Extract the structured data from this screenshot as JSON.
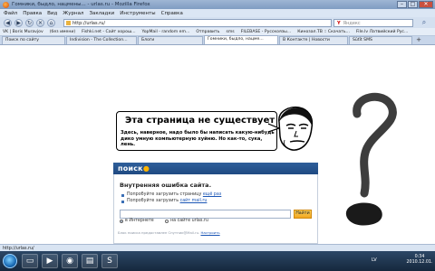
{
  "window": {
    "title": "Гомники, быдло, нацмены... - urlas.ru - Mozilla Firefox",
    "buttons": [
      "–",
      "□",
      "✕"
    ]
  },
  "menu": [
    "Файл",
    "Правка",
    "Вид",
    "Журнал",
    "Закладки",
    "Инструменты",
    "Справка"
  ],
  "nav": {
    "url": "http://urlas.ru/",
    "search_placeholder": "Яндекс",
    "search_engine_glyph": "Y"
  },
  "bookmarks": [
    "VK | Boris Muravjov",
    "(без имени)",
    "Fishki.net - Сайт хорош...",
    "YopMail - random em...",
    "Отправить",
    "sms",
    "FILEBASE - Русскоязы...",
    "Кинозал.ТВ :: Скачать...",
    "File.lv Латвийский Рус..."
  ],
  "tabs": [
    {
      "label": "Поиск по сайту",
      "active": false
    },
    {
      "label": "Indivision - The Collection...",
      "active": false
    },
    {
      "label": "Блоги",
      "active": false
    },
    {
      "label": "Гомники, быдло, нацме...",
      "active": true
    },
    {
      "label": "В Контакте | Новости",
      "active": false
    },
    {
      "label": "Sūtīt SMS",
      "active": false
    }
  ],
  "bubble": {
    "title": "Эта страница не существует",
    "text": "Здесь, наверное, надо было бы написать какую-нибудь дико умную компьютерную хуйню. Но как-то, сука, лень."
  },
  "poisk": {
    "logo": "поиск",
    "error_title": "Внутренняя ошибка сайта.",
    "line1_prefix": "Попробуйте загрузить страницу",
    "line1_link": "ещё раз",
    "line2_prefix": "Попробуйте загрузить",
    "line2_link": "сайт mail.ru",
    "find_button": "Найти",
    "radio_internet": "в Интернете",
    "radio_site": "на сайте urlas.ru",
    "footnote_text": "Блок поиска предоставлен Спутник@Mail.ru.",
    "footnote_link": "Настроить"
  },
  "status": {
    "text": "http://urlas.ru/"
  },
  "taskbar": {
    "lang": "LV",
    "time": "0:34",
    "date": "2010.12.01."
  },
  "colors": {
    "poisk_bar": "#1f4a82",
    "accent_orange": "#f0a51f",
    "link_blue": "#1a55b5"
  }
}
